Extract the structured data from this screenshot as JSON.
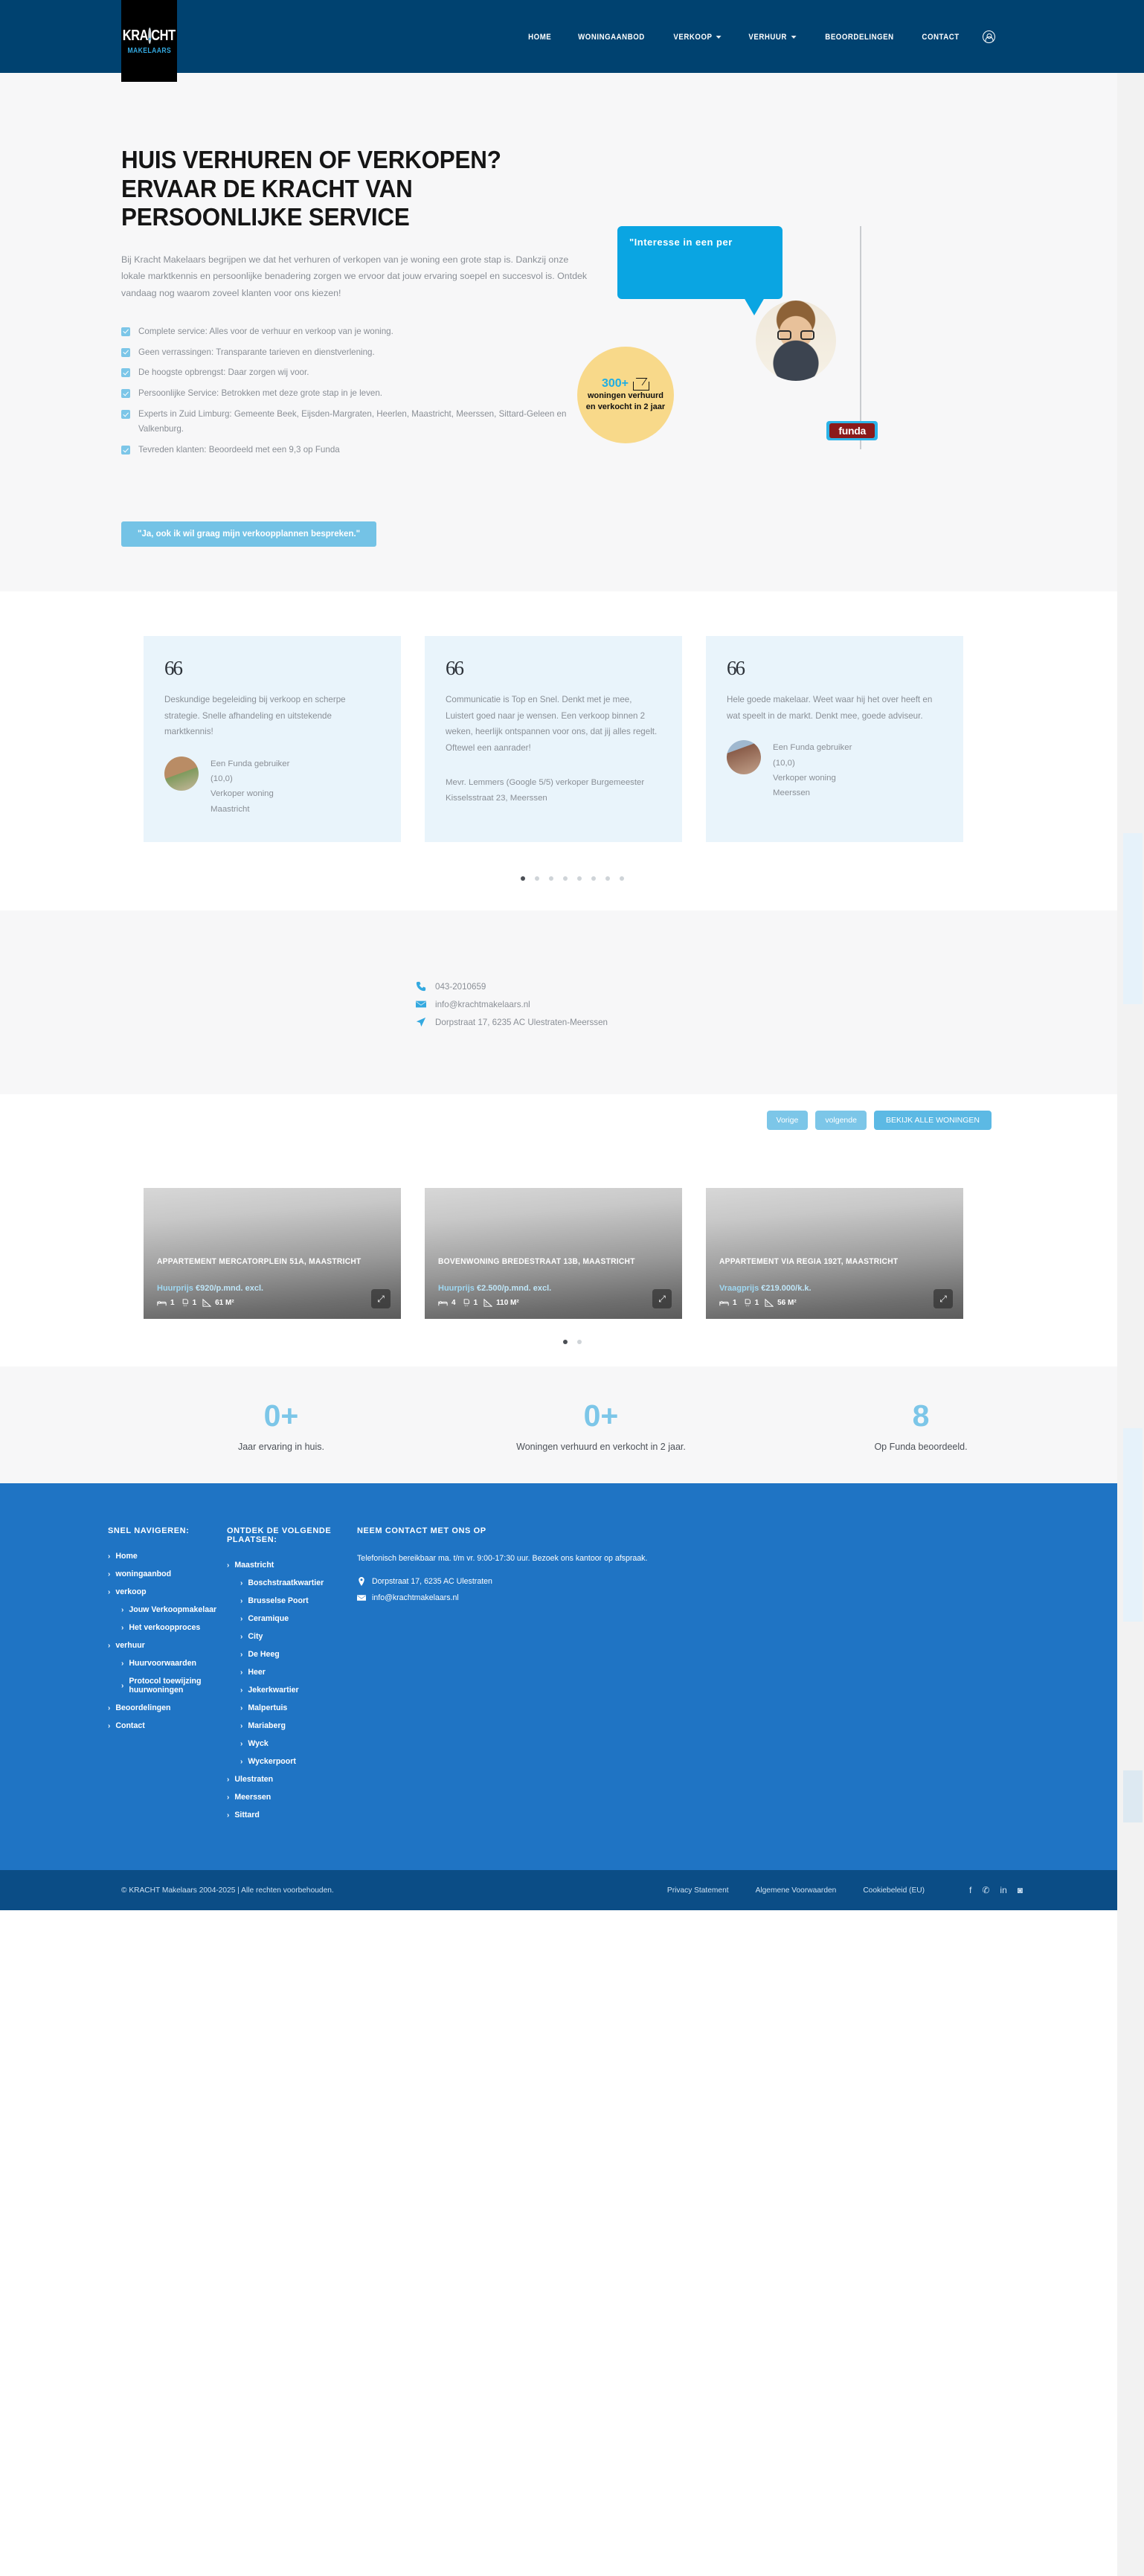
{
  "brand": {
    "logo_main": "KRA.CHT",
    "logo_dot": ".",
    "logo_sub": "MAKELAARS",
    "accent": "#34a9e0",
    "header_bg": "#004270",
    "footer_bg": "#1f74c4",
    "footer_bottom_bg": "#0b4d86"
  },
  "nav": {
    "items": [
      {
        "label": "HOME",
        "has_caret": false
      },
      {
        "label": "WONINGAANBOD",
        "has_caret": false
      },
      {
        "label": "VERKOOP",
        "has_caret": true
      },
      {
        "label": "VERHUUR",
        "has_caret": true
      },
      {
        "label": "BEOORDELINGEN",
        "has_caret": false
      },
      {
        "label": "CONTACT",
        "has_caret": false
      }
    ],
    "account_icon": "account-circle-icon"
  },
  "hero": {
    "title": "HUIS VERHUREN OF VERKOPEN? ERVAAR DE KRACHT VAN PERSOONLIJKE SERVICE",
    "description": "Bij Kracht Makelaars begrijpen we dat het verhuren of verkopen van je woning een grote stap is. Dankzij onze lokale marktkennis en persoonlijke benadering zorgen we ervoor dat jouw ervaring soepel en succesvol is. Ontdek vandaag nog waarom zoveel klanten voor ons kiezen!",
    "checklist": [
      "Complete service: Alles voor de verhuur en verkoop van je woning.",
      "Geen verrassingen: Transparante tarieven en dienstverlening.",
      "De hoogste opbrengst: Daar zorgen wij voor.",
      "Persoonlijke Service: Betrokken met deze grote stap in je leven.",
      "Experts in Zuid Limburg: Gemeente Beek, Eijsden-Margraten, Heerlen, Maastricht, Meerssen, Sittard-Geleen en Valkenburg.",
      "Tevreden klanten: Beoordeeld met een 9,3 op Funda"
    ],
    "cta_label": "\"Ja, ook ik wil graag mijn verkoopplannen bespreken.\"",
    "bubble_text": "\"Interesse in een per",
    "badge": {
      "number": "300+",
      "line1": "woningen verhuurd",
      "line2": "en verkocht in 2 jaar",
      "bg": "#f8d98a"
    },
    "funda_label": "funda"
  },
  "testimonials": {
    "cards": [
      {
        "quote_mark": "66",
        "body": "Deskundige begeleiding bij verkoop en scherpe strategie. Snelle afhandeling en uitstekende marktkennis!",
        "author": "Een Funda gebruiker",
        "rating": "(10,0)",
        "role": "Verkoper woning",
        "place": "Maastricht",
        "has_avatar": true,
        "avatar_class": "a"
      },
      {
        "quote_mark": "66",
        "body": "Communicatie is Top en Snel. Denkt met je mee, Luistert goed naar je wensen. Een verkoop binnen 2 weken, heerlijk ontspannen voor ons, dat jij alles regelt. Oftewel een aanrader!",
        "attrib": "Mevr. Lemmers (Google 5/5) verkoper Burgemeester Kisselsstraat 23, Meerssen",
        "has_avatar": false
      },
      {
        "quote_mark": "66",
        "body": "Hele goede makelaar. Weet waar hij het over heeft en wat speelt in de markt. Denkt mee, goede adviseur.",
        "author": "Een Funda gebruiker",
        "rating": "(10,0)",
        "role": "Verkoper woning",
        "place": "Meerssen",
        "has_avatar": true,
        "avatar_class": "b"
      }
    ],
    "dot_count": 8,
    "active_dot": 0
  },
  "contact": {
    "phone": "043-2010659",
    "email": "info@krachtmakelaars.nl",
    "address": "Dorpstraat 17, 6235 AC Ulestraten-Meerssen",
    "phone_icon": "phone-icon",
    "email_icon": "mail-icon",
    "address_icon": "location-arrow-icon"
  },
  "listings": {
    "buttons": {
      "prev": "Vorige",
      "next": "volgende",
      "all": "BEKIJK ALLE WONINGEN"
    },
    "cards": [
      {
        "title": "APPARTEMENT MERCATORPLEIN 51A, MAASTRICHT",
        "price_label": "Huurprijs",
        "price_value": "€920/p.mnd. excl.",
        "beds": "1",
        "baths": "1",
        "area": "61 M²",
        "expand_icon": "expand-icon"
      },
      {
        "title": "BOVENWONING BREDESTRAAT 13B, MAASTRICHT",
        "price_label": "Huurprijs",
        "price_value": "€2.500/p.mnd. excl.",
        "beds": "4",
        "baths": "1",
        "area": "110 M²",
        "expand_icon": "expand-icon"
      },
      {
        "title": "APPARTEMENT VIA REGIA 192T, MAASTRICHT",
        "price_label": "Vraagprijs",
        "price_value": "€219.000/k.k.",
        "beds": "1",
        "baths": "1",
        "area": "56 M²",
        "expand_icon": "expand-icon"
      }
    ],
    "dot_count": 2,
    "active_dot": 0
  },
  "stats": [
    {
      "value": "0+",
      "label": "Jaar ervaring in huis."
    },
    {
      "value": "0+",
      "label": "Woningen verhuurd en verkocht in 2 jaar."
    },
    {
      "value": "8",
      "label": "Op Funda beoordeeld."
    }
  ],
  "footer": {
    "col1": {
      "heading": "SNEL NAVIGEREN:",
      "links": [
        {
          "label": "Home",
          "indent": false
        },
        {
          "label": "woningaanbod",
          "indent": false
        },
        {
          "label": "verkoop",
          "indent": false
        },
        {
          "label": "Jouw Verkoopmakelaar",
          "indent": true
        },
        {
          "label": "Het verkoopproces",
          "indent": true
        },
        {
          "label": "verhuur",
          "indent": false
        },
        {
          "label": "Huurvoorwaarden",
          "indent": true
        },
        {
          "label": "Protocol toewijzing huurwoningen",
          "indent": true
        },
        {
          "label": "Beoordelingen",
          "indent": false
        },
        {
          "label": "Contact",
          "indent": false
        }
      ]
    },
    "col2": {
      "heading": "ONTDEK DE VOLGENDE PLAATSEN:",
      "links": [
        {
          "label": "Maastricht",
          "indent": false
        },
        {
          "label": "Boschstraatkwartier",
          "indent": true
        },
        {
          "label": "Brusselse Poort",
          "indent": true
        },
        {
          "label": "Ceramique",
          "indent": true
        },
        {
          "label": "City",
          "indent": true
        },
        {
          "label": "De Heeg",
          "indent": true
        },
        {
          "label": "Heer",
          "indent": true
        },
        {
          "label": "Jekerkwartier",
          "indent": true
        },
        {
          "label": "Malpertuis",
          "indent": true
        },
        {
          "label": "Mariaberg",
          "indent": true
        },
        {
          "label": "Wyck",
          "indent": true
        },
        {
          "label": "Wyckerpoort",
          "indent": true
        },
        {
          "label": "Ulestraten",
          "indent": false
        },
        {
          "label": "Meerssen",
          "indent": false
        },
        {
          "label": "Sittard",
          "indent": false
        }
      ]
    },
    "col3": {
      "heading": "NEEM CONTACT MET ONS OP",
      "text": "Telefonisch bereikbaar ma. t/m vr. 9:00-17:30 uur. Bezoek ons kantoor op afspraak.",
      "address": "Dorpstraat 17, 6235 AC Ulestraten",
      "email": "info@krachtmakelaars.nl"
    },
    "bottom": {
      "copyright": "© KRACHT Makelaars 2004-2025 | Alle rechten voorbehouden.",
      "links": [
        "Privacy Statement",
        "Algemene Voorwaarden",
        "Cookiebeleid (EU)"
      ],
      "socials": [
        "facebook-icon",
        "whatsapp-icon",
        "linkedin-icon",
        "instagram-icon"
      ]
    }
  }
}
